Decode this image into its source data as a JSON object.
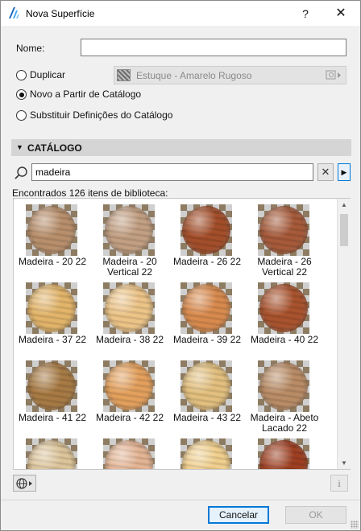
{
  "window": {
    "title": "Nova Superfície",
    "help_label": "?",
    "close_label": "✕"
  },
  "form": {
    "name_label": "Nome:",
    "name_value": "",
    "options": [
      {
        "label": "Duplicar",
        "checked": false
      },
      {
        "label": "Novo a Partir de Catálogo",
        "checked": true
      },
      {
        "label": "Substituir Definições do Catálogo",
        "checked": false
      }
    ],
    "duplicate_source": "Estuque - Amarelo Rugoso"
  },
  "catalog": {
    "section_title": "CATÁLOGO",
    "search_value": "madeira",
    "clear_label": "✕",
    "found_text": "Encontrados 126 itens de biblioteca:",
    "items": [
      {
        "name": "Madeira - 20 22",
        "color": "#b88f6c"
      },
      {
        "name": "Madeira - 20 Vertical 22",
        "color": "#c29f82"
      },
      {
        "name": "Madeira - 26 22",
        "color": "#a34e2a"
      },
      {
        "name": "Madeira - 26 Vertical 22",
        "color": "#a65a3a"
      },
      {
        "name": "Madeira - 37 22",
        "color": "#e2b46a"
      },
      {
        "name": "Madeira - 38 22",
        "color": "#ecc488"
      },
      {
        "name": "Madeira - 39 22",
        "color": "#d88a4e"
      },
      {
        "name": "Madeira - 40 22",
        "color": "#a9532e"
      },
      {
        "name": "Madeira - 41 22",
        "color": "#a77a44"
      },
      {
        "name": "Madeira - 42 22",
        "color": "#e3a05d"
      },
      {
        "name": "Madeira - 43 22",
        "color": "#e2bf7e"
      },
      {
        "name": "Madeira - Abeto Lacado 22",
        "color": "#b98c66"
      },
      {
        "name": "",
        "color": "#dcc49a"
      },
      {
        "name": "",
        "color": "#e3b494"
      },
      {
        "name": "",
        "color": "#f0cf8e"
      },
      {
        "name": "",
        "color": "#9e3f22"
      }
    ]
  },
  "footer": {
    "cancel_label": "Cancelar",
    "ok_label": "OK"
  },
  "colors": {
    "accent": "#0078d7",
    "section_bg": "#d5d5d5"
  }
}
